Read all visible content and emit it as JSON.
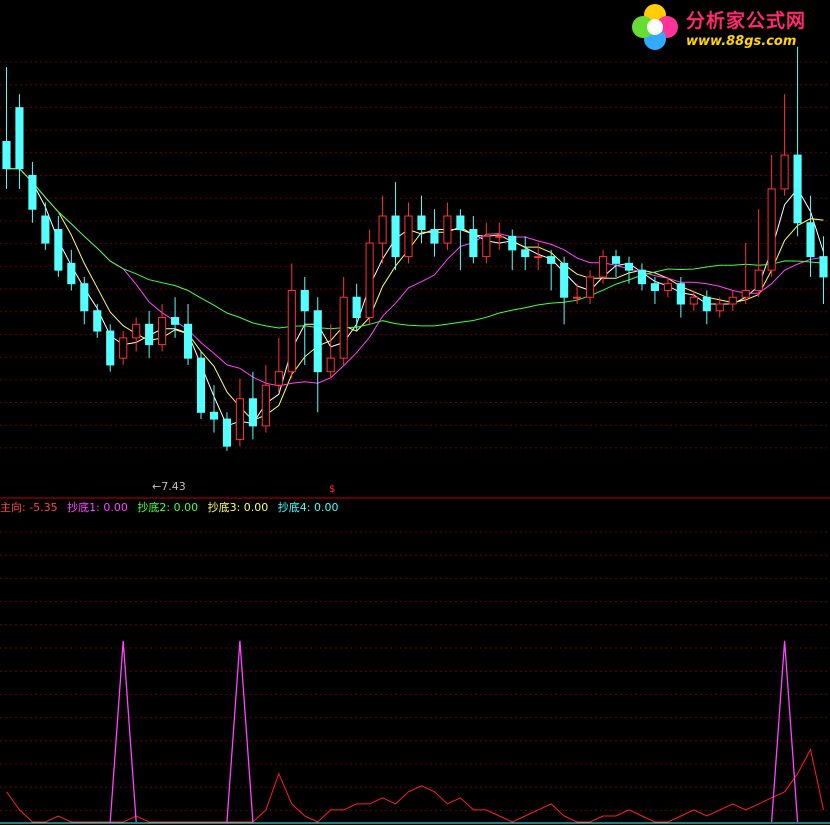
{
  "chart_data": {
    "type": "candlestick",
    "main_panel": {
      "title": "",
      "ylim": [
        7.0,
        13.5
      ],
      "grid": "dashed horizontal",
      "annotations": [
        {
          "text": "←7.43",
          "price": 7.43
        }
      ],
      "moving_averages": [
        {
          "color": "#ffffff"
        },
        {
          "color": "#ffff66"
        },
        {
          "color": "#ff44ff"
        },
        {
          "color": "#44ff44"
        }
      ],
      "candles": [
        [
          12.0,
          11.6,
          13.1,
          11.3
        ],
        [
          12.5,
          11.6,
          12.7,
          11.3
        ],
        [
          11.5,
          11.0,
          11.7,
          10.8
        ],
        [
          10.9,
          10.5,
          11.1,
          10.4
        ],
        [
          10.7,
          10.1,
          10.9,
          10.0
        ],
        [
          10.2,
          9.9,
          10.4,
          9.8
        ],
        [
          9.9,
          9.5,
          10.0,
          9.3
        ],
        [
          9.5,
          9.2,
          9.6,
          9.1
        ],
        [
          9.2,
          8.7,
          9.3,
          8.6
        ],
        [
          8.8,
          9.1,
          9.2,
          8.7
        ],
        [
          9.1,
          9.3,
          9.4,
          8.9
        ],
        [
          9.3,
          9.0,
          9.5,
          8.8
        ],
        [
          9.0,
          9.4,
          9.6,
          8.9
        ],
        [
          9.4,
          9.3,
          9.7,
          9.1
        ],
        [
          9.3,
          8.8,
          9.6,
          8.7
        ],
        [
          8.8,
          8.0,
          8.9,
          7.9
        ],
        [
          8.0,
          7.9,
          8.4,
          7.7
        ],
        [
          7.9,
          7.5,
          8.0,
          7.43
        ],
        [
          7.6,
          8.2,
          8.5,
          7.5
        ],
        [
          8.2,
          7.8,
          8.6,
          7.6
        ],
        [
          7.8,
          8.4,
          8.7,
          7.7
        ],
        [
          8.4,
          8.6,
          9.1,
          8.3
        ],
        [
          8.6,
          9.8,
          10.2,
          8.5
        ],
        [
          9.8,
          9.5,
          10.0,
          8.7
        ],
        [
          9.5,
          8.6,
          9.7,
          8.0
        ],
        [
          8.6,
          8.8,
          9.3,
          8.5
        ],
        [
          8.8,
          9.7,
          10.0,
          8.7
        ],
        [
          9.7,
          9.4,
          9.9,
          9.2
        ],
        [
          9.4,
          10.5,
          10.7,
          9.3
        ],
        [
          10.5,
          10.9,
          11.2,
          10.2
        ],
        [
          10.9,
          10.3,
          11.4,
          10.1
        ],
        [
          10.3,
          10.9,
          11.1,
          10.2
        ],
        [
          10.9,
          10.7,
          11.2,
          10.5
        ],
        [
          10.7,
          10.5,
          11.0,
          10.3
        ],
        [
          10.5,
          10.9,
          11.1,
          10.4
        ],
        [
          10.9,
          10.7,
          11.0,
          10.1
        ],
        [
          10.7,
          10.3,
          10.9,
          10.2
        ],
        [
          10.3,
          10.6,
          10.8,
          10.2
        ],
        [
          10.6,
          10.6,
          10.8,
          10.4
        ],
        [
          10.6,
          10.4,
          10.7,
          10.1
        ],
        [
          10.4,
          10.3,
          10.6,
          10.1
        ],
        [
          10.3,
          10.3,
          10.5,
          10.1
        ],
        [
          10.3,
          10.2,
          10.4,
          9.8
        ],
        [
          10.2,
          9.7,
          10.3,
          9.3
        ],
        [
          9.7,
          9.7,
          9.9,
          9.6
        ],
        [
          9.7,
          10.0,
          10.1,
          9.6
        ],
        [
          10.0,
          10.3,
          10.4,
          9.9
        ],
        [
          10.3,
          10.2,
          10.4,
          10.0
        ],
        [
          10.2,
          10.1,
          10.3,
          9.9
        ],
        [
          10.1,
          9.9,
          10.2,
          9.8
        ],
        [
          9.9,
          9.8,
          10.0,
          9.6
        ],
        [
          9.8,
          9.9,
          10.0,
          9.7
        ],
        [
          9.9,
          9.6,
          10.0,
          9.4
        ],
        [
          9.6,
          9.7,
          9.8,
          9.5
        ],
        [
          9.7,
          9.5,
          9.8,
          9.3
        ],
        [
          9.5,
          9.6,
          9.7,
          9.4
        ],
        [
          9.6,
          9.7,
          9.8,
          9.5
        ],
        [
          9.7,
          9.8,
          10.5,
          9.6
        ],
        [
          9.8,
          10.1,
          11.0,
          9.7
        ],
        [
          10.1,
          11.3,
          11.8,
          10.0
        ],
        [
          11.3,
          11.8,
          12.7,
          11.2
        ],
        [
          11.8,
          10.8,
          13.4,
          10.6
        ],
        [
          10.8,
          10.3,
          11.2,
          10.0
        ],
        [
          10.3,
          10.0,
          10.6,
          9.6
        ]
      ],
      "up_color": "#ff3232",
      "down_color": "#54ffff"
    },
    "indicator_panel": {
      "labels": [
        {
          "text": "主向: -5.35",
          "color": "#ff4040"
        },
        {
          "text": "抄底1: 0.00",
          "color": "#ff44ff"
        },
        {
          "text": "抄底2: 0.00",
          "color": "#44ff44"
        },
        {
          "text": "抄底3: 0.00",
          "color": "#ffff66"
        },
        {
          "text": "抄底4: 0.00",
          "color": "#44ffff"
        }
      ],
      "spike_series": {
        "name": "抄底1",
        "color": "#ff44ff",
        "spike_indices": [
          9,
          18,
          60
        ],
        "spike_value": 100
      },
      "main_series": {
        "name": "主向",
        "color": "#ff2020",
        "values": [
          5,
          2,
          0,
          0,
          1,
          0,
          0,
          0,
          0,
          0,
          1,
          0,
          0,
          0,
          0,
          0,
          0,
          0,
          0,
          0,
          2,
          8,
          3,
          1,
          0,
          2,
          2,
          3,
          3,
          4,
          3,
          5,
          6,
          5,
          3,
          4,
          2,
          2,
          1,
          0,
          1,
          2,
          3,
          1,
          0,
          0,
          1,
          1,
          2,
          1,
          0,
          0,
          1,
          2,
          1,
          2,
          3,
          2,
          3,
          4,
          5,
          8,
          12,
          2
        ]
      }
    }
  },
  "logo": {
    "title": "分析家公式网",
    "url": "www.88gs.com"
  },
  "signal_marker": "$"
}
